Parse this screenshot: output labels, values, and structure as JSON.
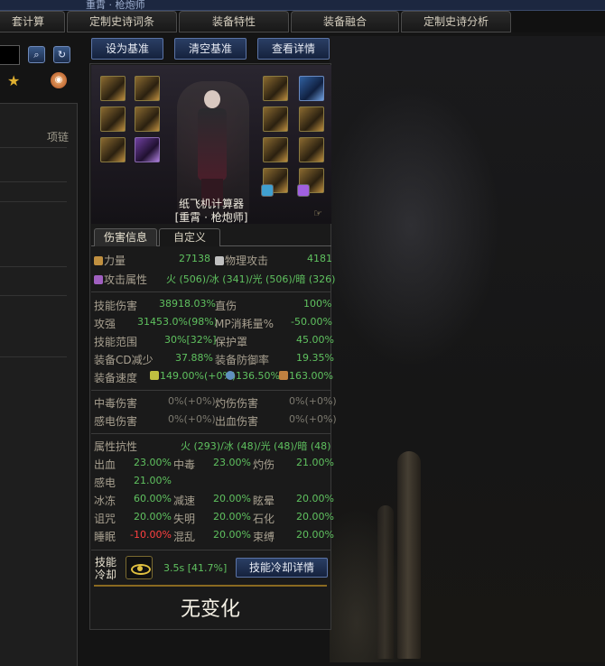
{
  "window": {
    "title_fragment": "重霄 · 枪炮师"
  },
  "tabs": [
    "套计算",
    "定制史诗词条",
    "装备特性",
    "装备融合",
    "定制史诗分析"
  ],
  "left_panel": {
    "slot_label": "项链"
  },
  "actions": {
    "set_baseline": "设为基准",
    "clear_baseline": "清空基准",
    "view_details": "查看详情"
  },
  "character": {
    "name": "纸飞机计算器",
    "class": "[重霄 · 枪炮师]"
  },
  "subtabs": {
    "damage": "伤害信息",
    "custom": "自定义"
  },
  "stats": {
    "strength": {
      "label": "力量",
      "value": "27138"
    },
    "phys_atk": {
      "label": "物理攻击",
      "value": "4181"
    },
    "atk_element": {
      "label": "攻击属性",
      "value": "火 (506)/冰 (341)/光 (506)/暗 (326)"
    },
    "skill_dmg": {
      "label": "技能伤害",
      "value": "38918.03%"
    },
    "crit": {
      "label": "直伤",
      "value": "100%"
    },
    "atk_power": {
      "label": "攻强",
      "value": "31453.0%(98%)"
    },
    "mp_cost": {
      "label": "MP消耗量%",
      "value": "-50.00%"
    },
    "skill_range": {
      "label": "技能范围",
      "value": "30%[32%]"
    },
    "shield": {
      "label": "保护罩",
      "value": "45.00%"
    },
    "cd_reduce": {
      "label": "装备CD减少",
      "value": "37.88%"
    },
    "defense_rate": {
      "label": "装备防御率",
      "value": "19.35%"
    },
    "equip_speed": {
      "label": "装备速度",
      "v1": "149.00%(+0%)",
      "v2": "136.50%",
      "v3": "163.00%"
    },
    "poison_dmg": {
      "label": "中毒伤害",
      "value": "0%(+0%)"
    },
    "burn_dmg": {
      "label": "灼伤伤害",
      "value": "0%(+0%)"
    },
    "shock_dmg": {
      "label": "感电伤害",
      "value": "0%(+0%)"
    },
    "bleed_dmg": {
      "label": "出血伤害",
      "value": "0%(+0%)"
    },
    "resist": {
      "label": "属性抗性",
      "value": "火 (293)/冰 (48)/光 (48)/暗 (48)"
    },
    "bleed": {
      "label": "出血",
      "value": "23.00%"
    },
    "poison": {
      "label": "中毒",
      "value": "23.00%"
    },
    "burn": {
      "label": "灼伤",
      "value": "21.00%"
    },
    "shock": {
      "label": "感电",
      "value": "21.00%"
    },
    "freeze": {
      "label": "冰冻",
      "value": "60.00%"
    },
    "slow": {
      "label": "减速",
      "value": "20.00%"
    },
    "stun": {
      "label": "眩晕",
      "value": "20.00%"
    },
    "curse": {
      "label": "诅咒",
      "value": "20.00%"
    },
    "blind": {
      "label": "失明",
      "value": "20.00%"
    },
    "petrify": {
      "label": "石化",
      "value": "20.00%"
    },
    "sleep": {
      "label": "睡眠",
      "value": "-10.00%"
    },
    "confuse": {
      "label": "混乱",
      "value": "20.00%"
    },
    "bind": {
      "label": "束缚",
      "value": "20.00%"
    }
  },
  "cooldown": {
    "label": "技能冷却",
    "value": "3.5s [41.7%]",
    "button": "技能冷却详情"
  },
  "summary": "无变化"
}
